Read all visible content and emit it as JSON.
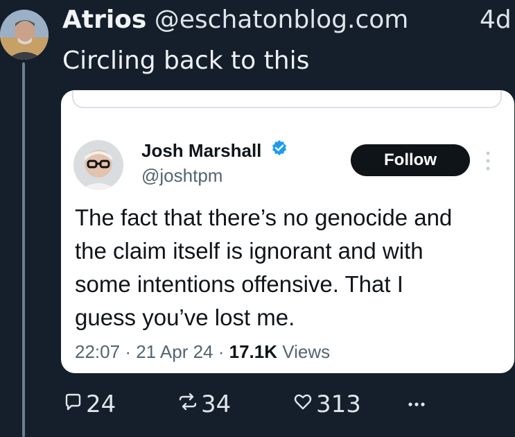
{
  "post": {
    "author_name": "Atrios",
    "author_handle": "@eschatonblog.com",
    "timestamp": "4d",
    "text": "Circling back to this"
  },
  "embed": {
    "name": "Josh Marshall",
    "handle": "@joshtpm",
    "follow_label": "Follow",
    "text_lines": [
      "The fact that there’s no genocide and",
      "the claim itself is ignorant and with",
      "some intentions offensive. That I",
      "guess you’ve lost me."
    ],
    "time": "22:07",
    "date": "21 Apr 24",
    "views_count": "17.1K",
    "views_label": "Views"
  },
  "actions": {
    "replies": "24",
    "reposts": "34",
    "likes": "313"
  },
  "icons": {
    "reply": "reply-icon",
    "repost": "repost-icon",
    "like": "heart-icon",
    "more": "more-horizontal-icon",
    "verified": "verified-badge-icon"
  },
  "colors": {
    "background": "#151f2b",
    "verified": "#1d9bf0",
    "follow_bg": "#0f1419"
  }
}
